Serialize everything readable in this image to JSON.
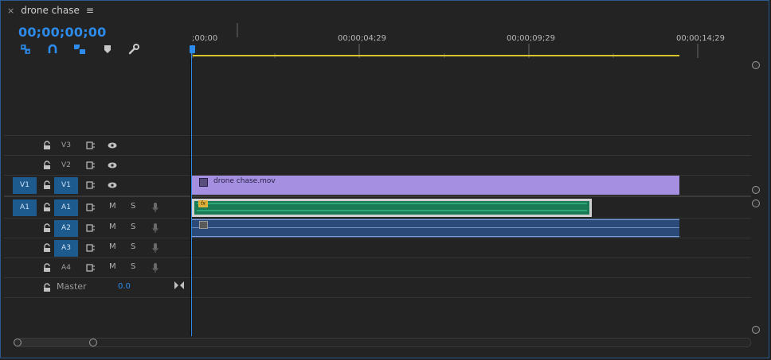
{
  "panel": {
    "sequence_name": "drone chase",
    "close_glyph": "×",
    "menu_glyph": "≡",
    "timecode": "00;00;00;00"
  },
  "ruler": {
    "labels": [
      ";00;00",
      "00;00;04;29",
      "00;00;09;29",
      "00;00;14;29"
    ]
  },
  "tracks": {
    "video": [
      {
        "source": "",
        "target": "V3",
        "source_on": false
      },
      {
        "source": "",
        "target": "V2",
        "source_on": false
      },
      {
        "source": "V1",
        "target": "V1",
        "source_on": true
      }
    ],
    "audio": [
      {
        "source": "A1",
        "target": "A1",
        "source_on": true
      },
      {
        "source": "",
        "target": "A2",
        "source_on": false
      },
      {
        "source": "",
        "target": "A3",
        "source_on": false
      },
      {
        "source": "",
        "target": "A4",
        "source_on": false
      }
    ],
    "mute_label": "M",
    "solo_label": "S",
    "master_label": "Master",
    "master_value": "0.0"
  },
  "clips": {
    "video_clip_name": "drone chase.mov",
    "fx_badge": "fx"
  },
  "colors": {
    "accent": "#2d8ceb",
    "video_clip": "#a48fe0",
    "audio_clip": "#1a7a55",
    "work_area": "#d6c62c"
  }
}
